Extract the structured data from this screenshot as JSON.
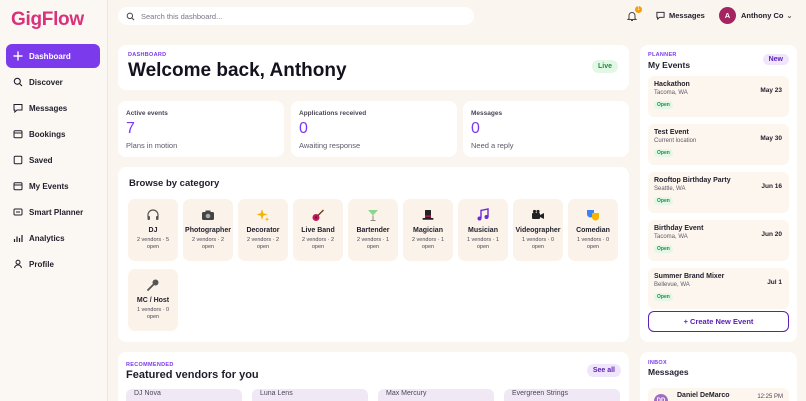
{
  "app": {
    "logo": "GigFlow"
  },
  "nav": [
    {
      "label": "Dashboard",
      "icon": "plus-icon",
      "active": true
    },
    {
      "label": "Discover",
      "icon": "search-icon"
    },
    {
      "label": "Messages",
      "icon": "message-icon"
    },
    {
      "label": "Bookings",
      "icon": "calendar-icon"
    },
    {
      "label": "Saved",
      "icon": "bookmark-icon"
    },
    {
      "label": "My Events",
      "icon": "calendar-icon"
    },
    {
      "label": "Smart Planner",
      "icon": "planner-icon"
    },
    {
      "label": "Analytics",
      "icon": "chart-icon"
    },
    {
      "label": "Profile",
      "icon": "user-icon"
    }
  ],
  "topbar": {
    "search_placeholder": "Search this dashboard...",
    "notification_count": "1",
    "messages_label": "Messages",
    "user_initial": "A",
    "user_name": "Anthony Co"
  },
  "welcome": {
    "eyebrow": "DASHBOARD",
    "title": "Welcome back, Anthony",
    "status": "Live"
  },
  "stats": [
    {
      "label": "Active events",
      "value": "7",
      "sub": "Plans in motion"
    },
    {
      "label": "Applications received",
      "value": "0",
      "sub": "Awaiting response"
    },
    {
      "label": "Messages",
      "value": "0",
      "sub": "Need a reply"
    }
  ],
  "browse": {
    "title": "Browse by category",
    "categories": [
      {
        "name": "DJ",
        "count": "2 vendors · 5 open",
        "icon": "headphones-icon"
      },
      {
        "name": "Photographer",
        "count": "2 vendors · 2 open",
        "icon": "camera-icon"
      },
      {
        "name": "Decorator",
        "count": "2 vendors · 2 open",
        "icon": "sparkles-icon"
      },
      {
        "name": "Live Band",
        "count": "2 vendors · 2 open",
        "icon": "guitar-icon"
      },
      {
        "name": "Bartender",
        "count": "2 vendors · 1 open",
        "icon": "cocktail-icon"
      },
      {
        "name": "Magician",
        "count": "2 vendors · 1 open",
        "icon": "top-hat-icon"
      },
      {
        "name": "Musician",
        "count": "1 vendors · 1 open",
        "icon": "music-note-icon"
      },
      {
        "name": "Videographer",
        "count": "1 vendors · 0 open",
        "icon": "video-camera-icon"
      },
      {
        "name": "Comedian",
        "count": "1 vendors · 0 open",
        "icon": "masks-icon"
      },
      {
        "name": "MC / Host",
        "count": "1 vendors · 0 open",
        "icon": "microphone-icon"
      }
    ]
  },
  "featured": {
    "eyebrow": "RECOMMENDED",
    "title": "Featured vendors for you",
    "see_all": "See all",
    "vendors": [
      "DJ Nova",
      "Luna Lens",
      "Max Mercury",
      "Evergreen Strings"
    ]
  },
  "planner": {
    "eyebrow": "PLANNER",
    "title": "My Events",
    "new_label": "New",
    "events": [
      {
        "name": "Hackathon",
        "location": "Tacoma, WA",
        "date": "May 23",
        "status": "Open"
      },
      {
        "name": "Test Event",
        "location": "Current location",
        "date": "May 30",
        "status": "Open"
      },
      {
        "name": "Rooftop Birthday Party",
        "location": "Seattle, WA",
        "date": "Jun 16",
        "status": "Open"
      },
      {
        "name": "Birthday Event",
        "location": "Tacoma, WA",
        "date": "Jun 20",
        "status": "Open"
      },
      {
        "name": "Summer Brand Mixer",
        "location": "Bellevue, WA",
        "date": "Jul 1",
        "status": "Open"
      }
    ],
    "create_label": "+ Create New Event"
  },
  "inbox": {
    "eyebrow": "INBOX",
    "title": "Messages",
    "first": {
      "initials": "DD",
      "name": "Daniel DeMarco",
      "time": "12:25 PM"
    }
  },
  "colors": {
    "brand": "#d9317a",
    "accent": "#7c3aed",
    "status_open": "#1a8f3a"
  }
}
